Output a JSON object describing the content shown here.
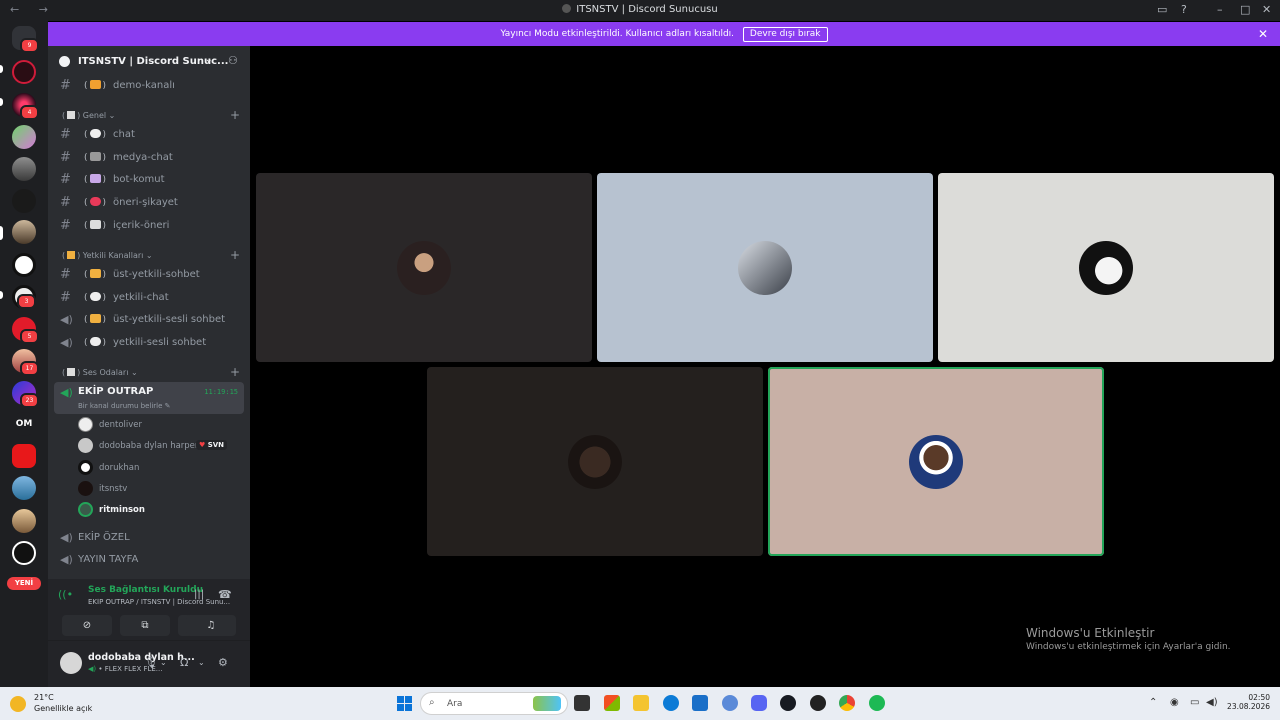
{
  "window": {
    "title": "ITSNSTV | Discord Sunucusu",
    "nav": "← →"
  },
  "banner": {
    "text": "Yayıncı Modu etkinleştirildi. Kullanıcı adları kısaltıldı.",
    "button": "Devre dışı bırak"
  },
  "server_rail": {
    "new_label": "YENİ",
    "om_label": "OM",
    "badges": [
      "9",
      "4",
      "3",
      "5",
      "17",
      "23"
    ]
  },
  "server": {
    "name": "ITSNSTV | Discord Sunuc..."
  },
  "channels": {
    "top": {
      "name": "demo-kanalı"
    },
    "genel_label": "Genel",
    "genel": [
      {
        "name": "chat"
      },
      {
        "name": "medya-chat"
      },
      {
        "name": "bot-komut"
      },
      {
        "name": "öneri-şikayet"
      },
      {
        "name": "içerik-öneri"
      }
    ],
    "yetkili_label": "Yetkili Kanalları",
    "yetkili": [
      {
        "name": "üst-yetkili-sohbet"
      },
      {
        "name": "yetkili-chat"
      },
      {
        "name": "üst-yetkili-sesli sohbet"
      },
      {
        "name": "yetkili-sesli sohbet"
      }
    ],
    "ses_label": "Ses Odaları",
    "active_voice": {
      "name": "EKİP OUTRAP",
      "timer": "11:19:15",
      "status": "Bir kanal durumu belirle"
    },
    "members": [
      {
        "name": "dentoliver"
      },
      {
        "name": "dodobaba dylan harper",
        "tag": "SVN"
      },
      {
        "name": "dorukhan"
      },
      {
        "name": "itsnstv"
      },
      {
        "name": "ritminson"
      }
    ],
    "other_voice": [
      {
        "name": "EKİP ÖZEL"
      },
      {
        "name": "YAYIN TAYFA"
      }
    ]
  },
  "voice_panel": {
    "title": "Ses Bağlantısı Kuruldu",
    "subtitle": "EKİP OUTRAP / ITSNSTV | Discord Sunu..."
  },
  "user_panel": {
    "name": "dodobaba dylan h...",
    "status": "FLEX FLEX FLE..."
  },
  "watermark": {
    "line1": "Windows'u Etkinleştir",
    "line2": "Windows'u etkinleştirmek için Ayarlar'a gidin."
  },
  "taskbar": {
    "temp": "21°C",
    "condition": "Genellikle açık",
    "search_placeholder": "Ara",
    "time": "02:50",
    "date": "23.08.2026"
  },
  "colors": {
    "banner": "#8a3cf0",
    "speaking": "#23a559",
    "sidebar": "#2b2d31",
    "rail": "#1e1f22"
  }
}
